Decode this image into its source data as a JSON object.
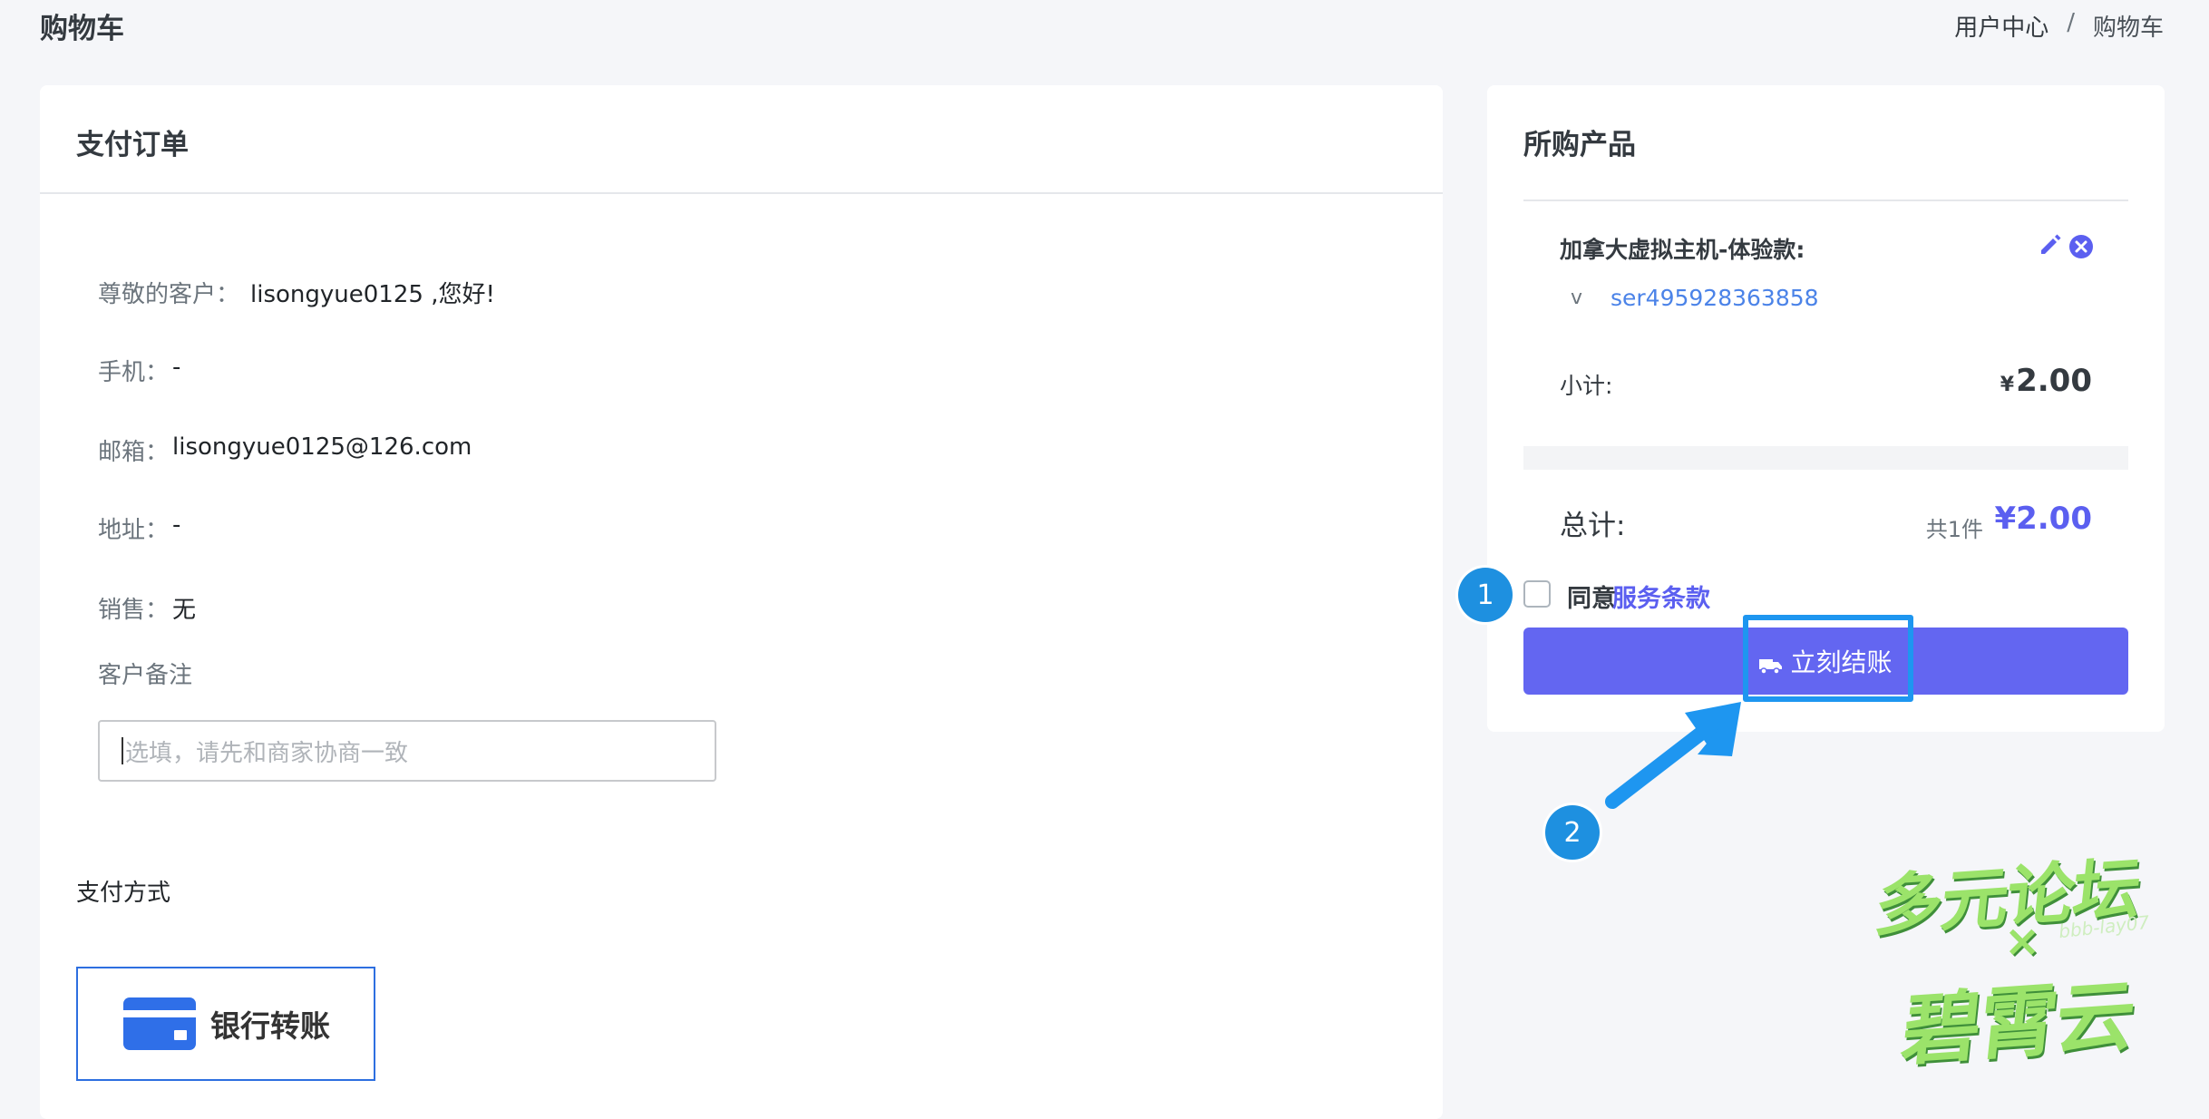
{
  "header": {
    "title": "购物车",
    "breadcrumb": [
      "用户中心",
      "/",
      "购物车"
    ]
  },
  "order": {
    "title": "支付订单",
    "customer_label": "尊敬的客户：",
    "customer_value": "lisongyue0125 ,您好!",
    "phone_label": "手机：",
    "phone_value": "-",
    "email_label": "邮箱：",
    "email_value": "lisongyue0125@126.com",
    "address_label": "地址：",
    "address_value": "-",
    "sales_label": "销售：",
    "sales_value": "无",
    "remark_label": "客户备注",
    "remark_placeholder": "选填，请先和商家协商一致",
    "payment_title": "支付方式",
    "payment_option": "银行转账"
  },
  "cart": {
    "title": "所购产品",
    "product_name": "加拿大虚拟主机-体验款:",
    "chevron": "v",
    "service_id": "ser495928363858",
    "subtotal_label": "小计:",
    "subtotal_currency": "¥",
    "subtotal_value": "2.00",
    "total_label": "总计:",
    "total_count": "共1件",
    "total_value": "¥2.00",
    "agree_text": "同意",
    "terms_link": "服务条款",
    "checkout_label": "立刻结账"
  },
  "annotations": {
    "step1": "1",
    "step2": "2"
  },
  "watermark": {
    "line1": "多元论坛",
    "cross": "×",
    "signature": "bbb-lay07",
    "line2": "碧霄云"
  },
  "colors": {
    "accent": "#6366f1",
    "link": "#4b83e8",
    "annotation": "#1e90e0",
    "page_bg": "#f5f6f9"
  },
  "icons": {
    "edit": "pencil-icon",
    "remove": "close-circle-icon",
    "checkout": "truck-icon",
    "payment": "credit-card-icon"
  }
}
